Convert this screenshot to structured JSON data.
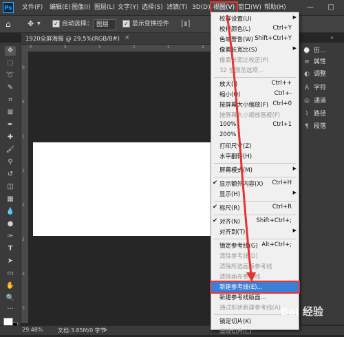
{
  "app": {
    "logo": "Ps"
  },
  "menubar": {
    "items": [
      "文件(F)",
      "编辑(E)",
      "图像(I)",
      "图层(L)",
      "文字(Y)",
      "选择(S)",
      "滤镜(T)",
      "3D(D)",
      "视图(V)",
      "窗口(W)",
      "帮助(H)"
    ],
    "window_buttons": [
      "—",
      "□"
    ]
  },
  "options_bar": {
    "auto_select_label": "自动选择：",
    "auto_select_value": "图层",
    "show_transform_label": "显示变换控件"
  },
  "document": {
    "tab_title": "1920全屏海报 @ 29.5%(RGB/8#)",
    "tab_close": "×",
    "ruler_top": [
      "0",
      "5",
      "1",
      "1",
      "2",
      "2"
    ],
    "ruler_left": [
      "0",
      "5",
      "1",
      "1",
      "2",
      "2",
      "3",
      "3"
    ]
  },
  "status": {
    "zoom": "29.48%",
    "doc_info": "文档:3.85M/0 字节",
    "arrow": ">"
  },
  "panels": [
    {
      "icon": "history-icon",
      "glyph": "⌚",
      "label": "历..."
    },
    {
      "icon": "properties-icon",
      "glyph": "≡",
      "label": "属性"
    },
    {
      "icon": "adjustments-icon",
      "glyph": "◐",
      "label": "调整"
    },
    {
      "icon": "character-icon",
      "glyph": "A",
      "label": "字符"
    },
    {
      "icon": "channels-icon",
      "glyph": "◎",
      "label": "通道"
    },
    {
      "icon": "paths-icon",
      "glyph": "⌇",
      "label": "路径"
    },
    {
      "icon": "paragraph-icon",
      "glyph": "¶",
      "label": "段落"
    }
  ],
  "view_menu": {
    "items": [
      {
        "label": "校样设置(U)",
        "shortcut": "",
        "submenu": true,
        "disabled": false
      },
      {
        "label": "校样颜色(L)",
        "shortcut": "Ctrl+Y",
        "submenu": false,
        "disabled": false
      },
      {
        "label": "色域警告(W)",
        "shortcut": "Shift+Ctrl+Y",
        "submenu": false,
        "disabled": false
      },
      {
        "label": "像素长宽比(S)",
        "shortcut": "",
        "submenu": true,
        "disabled": false
      },
      {
        "label": "像素长宽比校正(P)",
        "shortcut": "",
        "submenu": false,
        "disabled": true
      },
      {
        "label": "32 位预览选项...",
        "shortcut": "",
        "submenu": false,
        "disabled": true
      },
      {
        "label": "放大(I)",
        "shortcut": "Ctrl++",
        "submenu": false,
        "disabled": false
      },
      {
        "label": "缩小(O)",
        "shortcut": "Ctrl+-",
        "submenu": false,
        "disabled": false
      },
      {
        "label": "按屏幕大小缩放(F)",
        "shortcut": "Ctrl+0",
        "submenu": false,
        "disabled": false
      },
      {
        "label": "按屏幕大小缩放画板(F)",
        "shortcut": "",
        "submenu": false,
        "disabled": true
      },
      {
        "label": "100%",
        "shortcut": "Ctrl+1",
        "submenu": false,
        "disabled": false
      },
      {
        "label": "200%",
        "shortcut": "",
        "submenu": false,
        "disabled": false
      },
      {
        "label": "打印尺寸(Z)",
        "shortcut": "",
        "submenu": false,
        "disabled": false
      },
      {
        "label": "水平翻转(H)",
        "shortcut": "",
        "submenu": false,
        "disabled": false
      },
      {
        "label": "屏幕模式(M)",
        "shortcut": "",
        "submenu": true,
        "disabled": false
      },
      {
        "label": "显示额外内容(X)",
        "shortcut": "Ctrl+H",
        "submenu": false,
        "disabled": false,
        "checked": true
      },
      {
        "label": "显示(H)",
        "shortcut": "",
        "submenu": true,
        "disabled": false
      },
      {
        "label": "标尺(R)",
        "shortcut": "Ctrl+R",
        "submenu": false,
        "disabled": false,
        "checked": true
      },
      {
        "label": "对齐(N)",
        "shortcut": "Shift+Ctrl+;",
        "submenu": false,
        "disabled": false,
        "checked": true
      },
      {
        "label": "对齐到(T)",
        "shortcut": "",
        "submenu": true,
        "disabled": false
      },
      {
        "label": "锁定参考线(G)",
        "shortcut": "Alt+Ctrl+;",
        "submenu": false,
        "disabled": false
      },
      {
        "label": "清除参考线(D)",
        "shortcut": "",
        "submenu": false,
        "disabled": true
      },
      {
        "label": "清除所选画板参考线",
        "shortcut": "",
        "submenu": false,
        "disabled": true
      },
      {
        "label": "清除画布参考线",
        "shortcut": "",
        "submenu": false,
        "disabled": true
      },
      {
        "label": "新建参考线(E)...",
        "shortcut": "",
        "submenu": false,
        "disabled": false,
        "highlighted": true
      },
      {
        "label": "新建参考线版面...",
        "shortcut": "",
        "submenu": false,
        "disabled": false
      },
      {
        "label": "通过形状新建参考线(A)",
        "shortcut": "",
        "submenu": false,
        "disabled": true
      },
      {
        "label": "锁定切片(K)",
        "shortcut": "",
        "submenu": false,
        "disabled": false
      },
      {
        "label": "清除切片(C)",
        "shortcut": "",
        "submenu": false,
        "disabled": true
      }
    ]
  },
  "watermark": "Bai 经验",
  "colors": {
    "highlight": "#3d7fd6",
    "annotation": "#e33333",
    "accent": "#31a8ff"
  }
}
